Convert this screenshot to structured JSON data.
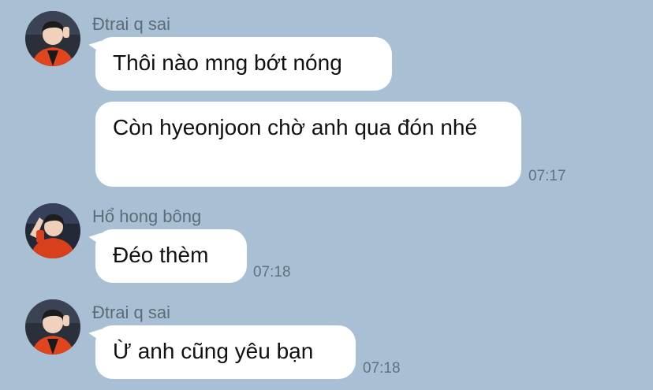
{
  "messages": [
    {
      "sender": "Đtrai q sai",
      "avatar_icon": "profile-photo-orange-jacket",
      "bubbles": [
        {
          "text": "Thôi nào mng bớt nóng",
          "time": ""
        },
        {
          "text": "Còn hyeonjoon chờ anh qua đón nhé",
          "time": "07:17"
        }
      ]
    },
    {
      "sender": "Hổ hong bông",
      "avatar_icon": "profile-photo-hand-pose",
      "bubbles": [
        {
          "text": "Đéo thèm",
          "time": "07:18"
        }
      ]
    },
    {
      "sender": "Đtrai q sai",
      "avatar_icon": "profile-photo-orange-jacket",
      "bubbles": [
        {
          "text": "Ừ anh cũng yêu bạn",
          "time": "07:18"
        }
      ]
    }
  ],
  "colors": {
    "background": "#a9c0d4",
    "bubble": "#ffffff",
    "sender_text": "#5b6b77",
    "time_text": "#5f7180",
    "jacket": "#e0451e"
  }
}
